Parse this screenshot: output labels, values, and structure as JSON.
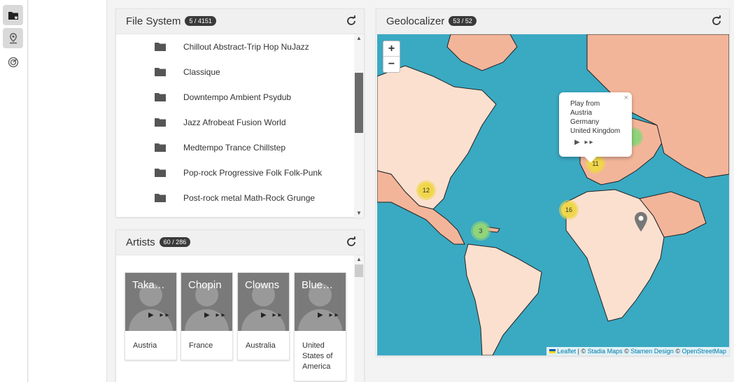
{
  "colors": {
    "accent": "#3a3a3a",
    "ocean": "#3aa9c2",
    "land": "#f3b59a",
    "cluster_yellow": "#f0d64a",
    "cluster_green": "#90d47a"
  },
  "sidebar": {
    "items": [
      {
        "icon": "folder-icon"
      },
      {
        "icon": "location-pin-icon"
      },
      {
        "icon": "radar-icon"
      }
    ]
  },
  "file_system": {
    "title": "File System",
    "badge": "5 / 4151",
    "items": [
      "Chillout Abstract-Trip Hop NuJazz",
      "Classique",
      "Downtempo Ambient Psydub",
      "Jazz Afrobeat Fusion World",
      "Medtempo Trance Chillstep",
      "Pop-rock Progressive Folk Folk-Punk",
      "Post-rock metal Math-Rock Grunge"
    ]
  },
  "artists": {
    "title": "Artists",
    "badge": "60 / 286",
    "cards": [
      {
        "name": "Taka…",
        "country": "Austria"
      },
      {
        "name": "Chopin",
        "country": "France"
      },
      {
        "name": "Clowns",
        "country": "Australia"
      },
      {
        "name": "Blue…",
        "country": "United States of America"
      }
    ]
  },
  "geo": {
    "title": "Geolocalizer",
    "badge": "53 / 52",
    "zoom_in": "+",
    "zoom_out": "−",
    "popup": {
      "heading": "Play from",
      "countries": [
        "Austria",
        "Germany",
        "United Kingdom"
      ],
      "close": "×"
    },
    "clusters": [
      {
        "count": "12"
      },
      {
        "count": "3"
      },
      {
        "count": "11"
      },
      {
        "count": "16"
      }
    ],
    "attribution": {
      "leaflet": "Leaflet",
      "stadia": "Stadia Maps",
      "stamen": "Stamen Design",
      "osm": "OpenStreetMap"
    }
  }
}
